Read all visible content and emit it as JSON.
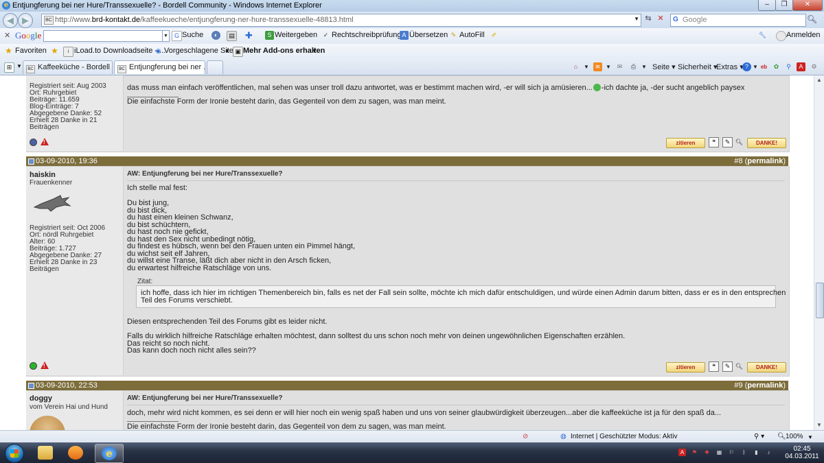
{
  "window": {
    "title": "Entjungferung bei ner Hure/Transsexuelle? - Bordell Community - Windows Internet Explorer",
    "icon": "ie-icon"
  },
  "address": {
    "url_prefix": "http://www.",
    "url_domain": "brd-kontakt.de",
    "url_path": "/kaffeekueche/entjungferung-ner-hure-transsexuelle-48813.html",
    "search_placeholder": "Google"
  },
  "google_toolbar": {
    "logo": [
      "G",
      "o",
      "o",
      "g",
      "l",
      "e"
    ],
    "search_label": "Suche",
    "share_label": "Weitergeben",
    "spell_label": "Rechtschreibprüfung",
    "translate_label": "Übersetzen",
    "autofill_label": "AutoFill",
    "signin_label": "Anmelden"
  },
  "favorites_bar": {
    "favorites_label": "Favoriten",
    "items": [
      "iLoad.to Downloadseite - ...",
      "Vorgeschlagene Sites",
      "Mehr Add-ons erhalten"
    ]
  },
  "tabs": [
    {
      "label": "Kaffeeküche - Bordell Co...",
      "active": false
    },
    {
      "label": "Entjungferung bei ner ...",
      "active": true
    }
  ],
  "command_bar": {
    "page": "Seite",
    "security": "Sicherheit",
    "extras": "Extras"
  },
  "posts": {
    "prev": {
      "info": [
        "Registriert seit: Aug 2003",
        "Ort: Ruhrgebiet",
        "Beiträge: 11.659",
        "Blog-Einträge: 7",
        "Abgegebene Danke: 52",
        "Erhielt 28 Danke in 21",
        "Beiträgen"
      ],
      "line1": "das muss man einfach veröffentlichen, mal sehen was unser troll dazu antwortet, was er bestimmt machen wird, -er will sich ja amüsieren...",
      "line1b": "-ich dachte ja, -der sucht angeblich paysex",
      "signature": "Die einfachste Form der Ironie besteht darin, das Gegenteil von dem zu sagen, was man meint.",
      "quote_btn": "zitieren",
      "thanks_btn": "DANKE!"
    },
    "p8": {
      "date": "03-09-2010, 19:36",
      "number": "#8",
      "permalink": "permalink",
      "username": "haiskin",
      "usertitle": "Frauenkenner",
      "info": [
        "Registriert seit: Oct 2006",
        "Ort: nördl Ruhrgebiet",
        "Alter: 60",
        "Beiträge: 1.727",
        "Abgegebene Danke: 27",
        "Erhielt 28 Danke in 23",
        "Beiträgen"
      ],
      "title": "AW: Entjungferung bei ner Hure/Transsexuelle?",
      "intro": "Ich stelle mal fest:",
      "lines": [
        "Du bist jung,",
        "du bist dick,",
        "du hast einen kleinen Schwanz,",
        "du bist schüchtern,",
        "du hast noch nie gefickt,",
        "du hast den Sex nicht unbedingt nötig,",
        "du findest es hübsch, wenn bei den Frauen unten ein Pimmel hängt,",
        "du wichst seit elf Jahren,",
        "du willst eine Transe, läßt dich aber nicht in den Arsch ficken,",
        "du erwartest hilfreiche Ratschläge von uns."
      ],
      "quote_label": "Zitat:",
      "quote_lines": [
        "ich hoffe, dass ich hier im richtigen Themenbereich bin, falls es net der Fall sein sollte, möchte ich mich dafür entschuldigen, und würde einen Admin darum bitten, dass er es in den entsprechen",
        "Teil des Forums verschiebt."
      ],
      "after1": "Diesen entsprechenden Teil des Forums gibt es leider nicht.",
      "after2": [
        "Falls du wirklich hilfreiche Ratschläge erhalten möchtest, dann solltest du uns schon noch mehr von deinen ungewöhnlichen Eigenschaften erzählen.",
        "Das reicht so noch nicht.",
        "Das kann doch noch nicht alles sein??"
      ],
      "quote_btn": "zitieren",
      "thanks_btn": "DANKE!",
      "online_color": "#2bb52b"
    },
    "p9": {
      "date": "03-09-2010, 22:53",
      "number": "#9",
      "permalink": "permalink",
      "username": "doggy",
      "usertitle": "vom Verein Hai und Hund",
      "title": "AW: Entjungferung bei ner Hure/Transsexuelle?",
      "line1": "doch, mehr wird nicht kommen, es sei denn er will hier noch ein wenig spaß haben und uns von seiner glaubwürdigkeit überzeugen...aber die kaffeeküche ist ja für den spaß da...",
      "signature": "Die einfachste Form der Ironie besteht darin, das Gegenteil von dem zu sagen, was man meint."
    }
  },
  "statusbar": {
    "zone": "Internet | Geschützter Modus: Aktiv",
    "zoom": "100%"
  },
  "taskbar": {
    "time": "02:45",
    "date": "04.03.2011"
  },
  "colors": {
    "post_header": "#7c6d3b",
    "post_bg": "#e0e0e0",
    "thanks_text": "#b0251b"
  }
}
